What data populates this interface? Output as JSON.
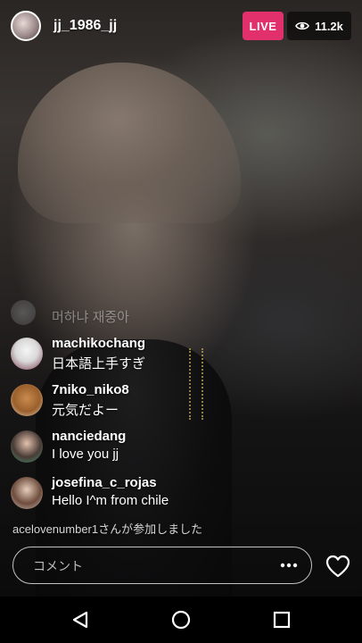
{
  "header": {
    "username": "jj_1986_jj",
    "live_label": "LIVE",
    "viewer_count": "11.2k",
    "eye_icon": "eye-icon"
  },
  "comments": [
    {
      "username": "",
      "text": "머하냐 재중아",
      "faded": true
    },
    {
      "username": "machikochang",
      "text": "日本語上手すぎ"
    },
    {
      "username": "7niko_niko8",
      "text": "元気だよー"
    },
    {
      "username": "nanciedang",
      "text": "I love you jj"
    },
    {
      "username": "josefina_c_rojas",
      "text": "Hello I^m from chile"
    }
  ],
  "join_notice": "acelovenumber1さんが参加しました",
  "comment_bar": {
    "placeholder": "コメント",
    "more_icon": "more-options-icon",
    "heart_icon": "heart-icon"
  },
  "navbar": {
    "back_icon": "back-icon",
    "home_icon": "home-icon",
    "recents_icon": "recents-icon"
  },
  "colors": {
    "live_badge": "#e1306c",
    "text": "#ffffff"
  }
}
